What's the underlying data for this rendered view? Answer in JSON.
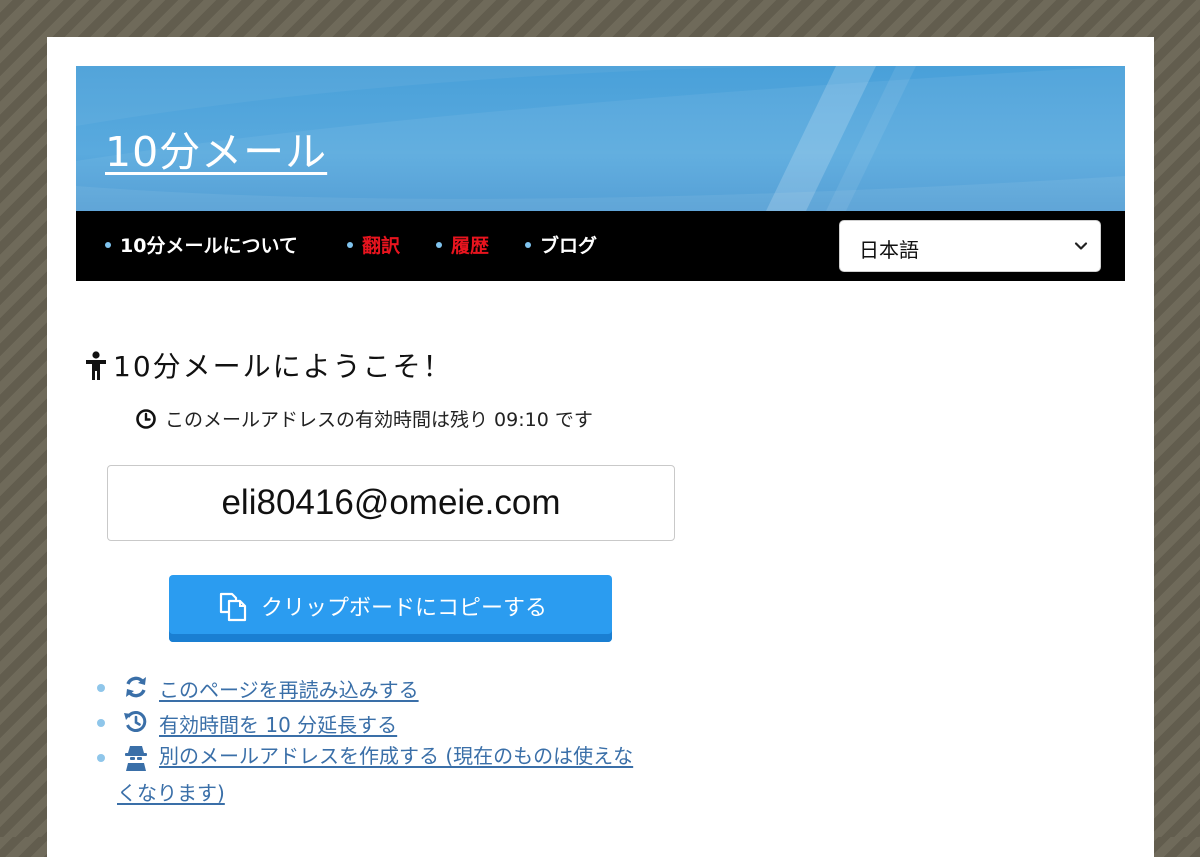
{
  "header": {
    "site_title": "10分メール"
  },
  "nav": {
    "items": [
      {
        "label": "10分メールについて",
        "color": "#ffffff"
      },
      {
        "label": "翻訳",
        "color": "#e8141e"
      },
      {
        "label": "履歴",
        "color": "#e8141e"
      },
      {
        "label": "ブログ",
        "color": "#ffffff"
      }
    ],
    "language_select": {
      "value": "日本語"
    }
  },
  "main": {
    "welcome_title": "10分メールにようこそ！",
    "timer_text": "このメールアドレスの有効時間は残り 09:10 です",
    "email_address": "eli80416@omeie.com",
    "copy_button_label": "クリップボードにコピーする",
    "links": [
      {
        "label": "このページを再読み込みする",
        "icon": "refresh-icon"
      },
      {
        "label": "有効時間を 10 分延長する",
        "icon": "history-icon"
      },
      {
        "label_line1": "別のメールアドレスを作成する (現在のものは使えな",
        "label_line2": "くなります)",
        "icon": "spy-icon"
      }
    ]
  },
  "colors": {
    "banner": "#4aa0d8",
    "navbar": "#000000",
    "button": "#2b9cf0",
    "link": "#3a6fa8",
    "accent_red": "#e8141e"
  }
}
